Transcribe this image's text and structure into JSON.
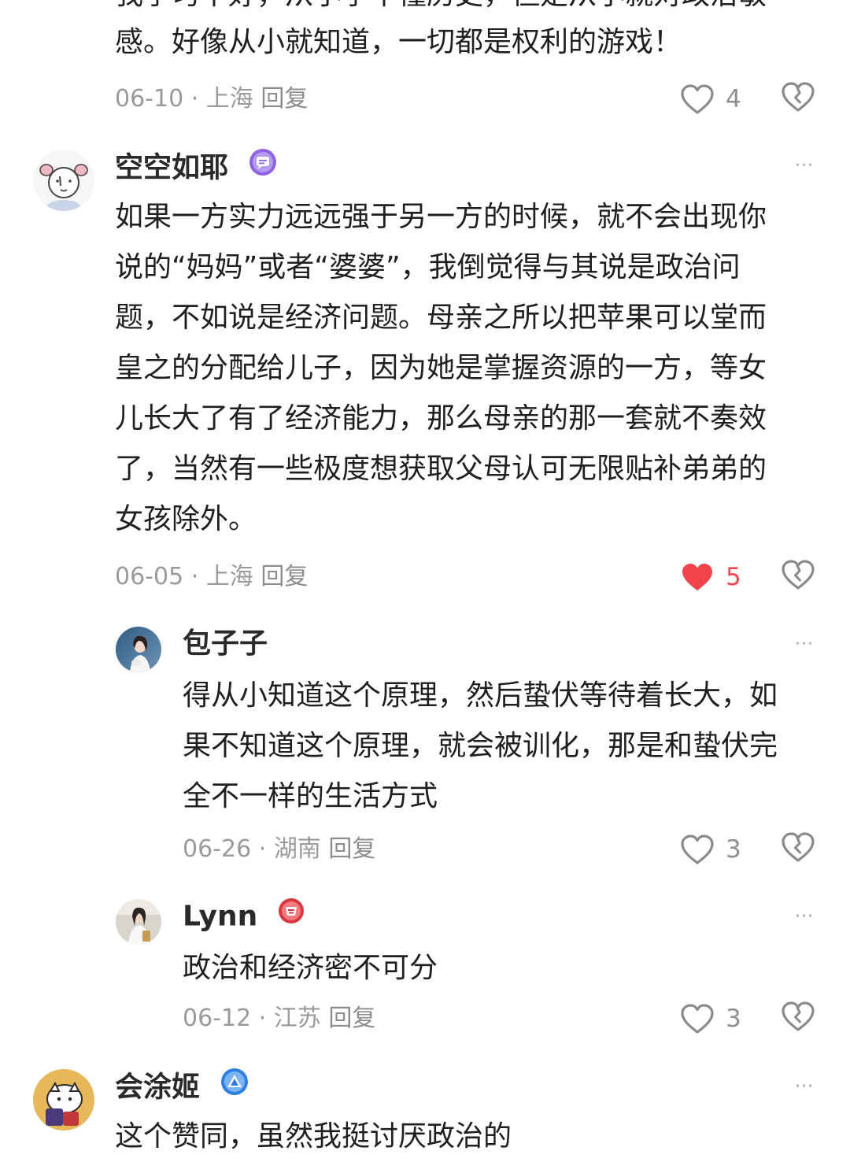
{
  "top_comment": {
    "text_line_cut": "我学习不好，从小学不懂历史，但是从小就对政治敏",
    "text_line": "感。好像从小就知道，一切都是权利的游戏！",
    "date": "06-10",
    "location": "上海",
    "reply_label": "回复",
    "likes": "4",
    "liked": false
  },
  "comments": [
    {
      "username": "空空如耶",
      "badge_icon": "chat-badge-icon",
      "more_label": "···",
      "text": "如果一方实力远远强于另一方的时候，就不会出现你说的“妈妈”或者“婆婆”，我倒觉得与其说是政治问题，不如说是经济问题。母亲之所以把苹果可以堂而皇之的分配给儿子，因为她是掌握资源的一方，等女儿长大了有了经济能力，那么母亲的那一套就不奏效了，当然有一些极度想获取父母认可无限贴补弟弟的女孩除外。",
      "text_lines": [
        "如果一方实力远远强于另一方的时候，就不会出现你",
        "说的“妈妈”或者“婆婆”，我倒觉得与其说是政治问",
        "题，不如说是经济问题。母亲之所以把苹果可以堂而",
        "皇之的分配给儿子，因为她是掌握资源的一方，等女",
        "儿长大了有了经济能力，那么母亲的那一套就不奏效",
        "了，当然有一些极度想获取父母认可无限贴补弟弟的",
        "女孩除外。"
      ],
      "date": "06-05",
      "location": "上海",
      "reply_label": "回复",
      "likes": "5",
      "liked": true,
      "replies": [
        {
          "username": "包子子",
          "more_label": "···",
          "text_lines": [
            "得从小知道这个原理，然后蛰伏等待着长大，如",
            "果不知道这个原理，就会被训化，那是和蛰伏完",
            "全不一样的生活方式"
          ],
          "date": "06-26",
          "location": "湖南",
          "reply_label": "回复",
          "likes": "3",
          "liked": false
        },
        {
          "username": "Lynn",
          "badge_icon": "red-rank-badge-icon",
          "more_label": "···",
          "text_lines": [
            "政治和经济密不可分"
          ],
          "date": "06-12",
          "location": "江苏",
          "reply_label": "回复",
          "likes": "3",
          "liked": false
        }
      ]
    },
    {
      "username": "会涂姬",
      "badge_icon": "blue-triangle-badge-icon",
      "more_label": "···",
      "text_line_cut": "这个赞同，虽然我挺讨厌政治的"
    }
  ],
  "colors": {
    "text": "#1f1f1f",
    "meta": "#9a9a9a",
    "like_active": "#f1444d",
    "icon_gray": "#8a8a8a"
  },
  "icons": [
    "heart-outline-icon",
    "heart-filled-icon",
    "dislike-heart-icon",
    "more-icon"
  ]
}
